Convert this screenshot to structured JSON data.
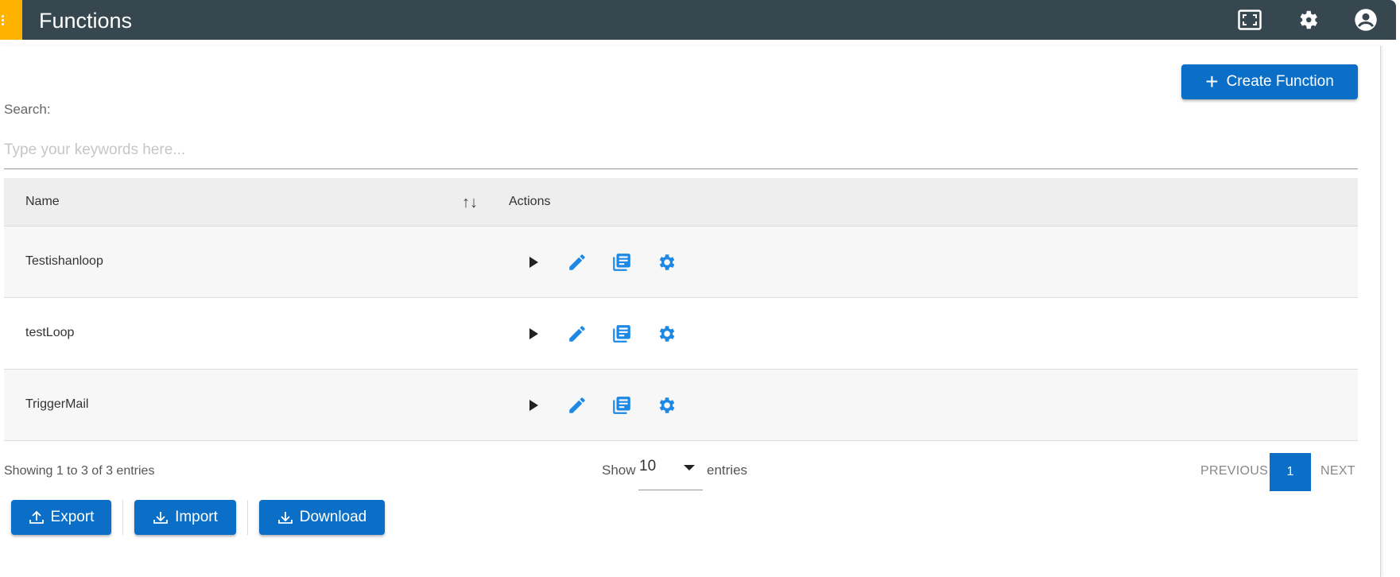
{
  "header": {
    "title": "Functions",
    "bg_color": "#37474f",
    "menu_color": "#ffb300",
    "icons": [
      "screenshot-frame-icon",
      "gear-icon",
      "account-circle-icon"
    ]
  },
  "toolbar": {
    "create_label": "Create Function",
    "accent_color": "#0b6fc7"
  },
  "search": {
    "label": "Search:",
    "placeholder": "Type your keywords here...",
    "value": ""
  },
  "table": {
    "columns": [
      "Name",
      "Actions"
    ],
    "rows": [
      {
        "name": "Testishanloop"
      },
      {
        "name": "testLoop"
      },
      {
        "name": "TriggerMail"
      }
    ],
    "action_icons": [
      "play-icon",
      "edit-icon",
      "logs-icon",
      "gear-icon"
    ]
  },
  "footer": {
    "showing": "Showing 1 to 3 of 3 entries",
    "show_label": "Show",
    "page_size": "10",
    "entries_label": "entries",
    "previous": "PREVIOUS",
    "current_page": "1",
    "next": "NEXT"
  },
  "actions": {
    "export_label": "Export",
    "import_label": "Import",
    "download_label": "Download"
  }
}
